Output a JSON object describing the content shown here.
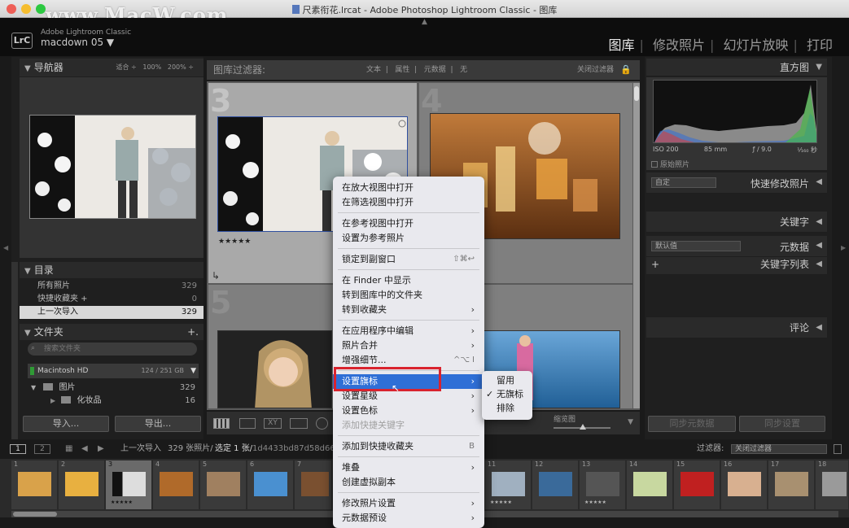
{
  "window": {
    "title": "尺素衔花.lrcat - Adobe Photoshop Lightroom Classic - 图库",
    "watermark": "www.MacW.com"
  },
  "identity": {
    "app": "Adobe Lightroom Classic",
    "user": "macdown 05 ▼",
    "badge": "LrC"
  },
  "modules": [
    "图库",
    "修改照片",
    "幻灯片放映",
    "打印"
  ],
  "navigator": {
    "title": "导航器",
    "zoom": [
      "适合 ÷",
      "100%",
      "200% ÷"
    ]
  },
  "catalog": {
    "title": "目录",
    "items": [
      {
        "label": "所有照片",
        "count": "329"
      },
      {
        "label": "快捷收藏夹 +",
        "count": "0"
      },
      {
        "label": "上一次导入",
        "count": "329"
      }
    ]
  },
  "folders": {
    "title": "文件夹",
    "search_placeholder": "搜索文件夹",
    "volume": "Macintosh HD",
    "volume_size": "124 / 251 GB",
    "items": [
      {
        "label": "图片",
        "count": "329"
      },
      {
        "label": "化妆品",
        "count": "16"
      }
    ]
  },
  "left_buttons": {
    "import": "导入...",
    "export": "导出..."
  },
  "filter_bar": {
    "label": "图库过滤器:",
    "options": [
      "文本",
      "属性",
      "元数据",
      "无"
    ],
    "close": "关闭过滤器"
  },
  "grid": {
    "cells": [
      "3",
      "4",
      "5"
    ],
    "rating": "★★★★★"
  },
  "right": {
    "histogram": "直方图",
    "iso": "ISO 200",
    "focal": "85 mm",
    "aperture": "ƒ / 9.0",
    "shutter": "¹⁄₁₆₀ 秒",
    "original": "原始照片",
    "preset": "自定",
    "quick_develop": "快速修改照片",
    "keywords": "关键字",
    "keyword_list": "关键字列表",
    "metadata_preset": "默认值",
    "metadata": "元数据",
    "comments": "评论",
    "sync_meta": "同步元数据",
    "sync_settings": "同步设置"
  },
  "toolbar": {
    "thumb_label": "缩览图"
  },
  "context_menu": [
    {
      "label": "在放大视图中打开",
      "shortcut": "",
      "arrow": false
    },
    {
      "label": "在筛选视图中打开",
      "shortcut": "",
      "arrow": false
    },
    {
      "label": "在参考视图中打开",
      "shortcut": "",
      "arrow": false
    },
    {
      "label": "设置为参考照片",
      "shortcut": "",
      "arrow": false
    },
    {
      "label": "锁定到副窗口",
      "shortcut": "⇧⌘↩",
      "arrow": false
    },
    {
      "label": "在 Finder 中显示",
      "shortcut": "",
      "arrow": false
    },
    {
      "label": "转到图库中的文件夹",
      "shortcut": "",
      "arrow": false
    },
    {
      "label": "转到收藏夹",
      "shortcut": "",
      "arrow": true
    },
    {
      "label": "在应用程序中编辑",
      "shortcut": "",
      "arrow": true
    },
    {
      "label": "照片合并",
      "shortcut": "",
      "arrow": true
    },
    {
      "label": "增强细节...",
      "shortcut": "^⌥ I",
      "arrow": false
    },
    {
      "label": "设置旗标",
      "shortcut": "",
      "arrow": true
    },
    {
      "label": "设置星级",
      "shortcut": "",
      "arrow": true
    },
    {
      "label": "设置色标",
      "shortcut": "",
      "arrow": true
    },
    {
      "label": "添加快捷关键字",
      "shortcut": "",
      "arrow": false
    },
    {
      "label": "添加到快捷收藏夹",
      "shortcut": "B",
      "arrow": false
    },
    {
      "label": "堆叠",
      "shortcut": "",
      "arrow": true
    },
    {
      "label": "创建虚拟副本",
      "shortcut": "",
      "arrow": false
    },
    {
      "label": "修改照片设置",
      "shortcut": "",
      "arrow": true
    },
    {
      "label": "元数据预设",
      "shortcut": "",
      "arrow": true
    }
  ],
  "submenu": [
    {
      "label": "留用"
    },
    {
      "label": "无旗标",
      "check": "✓"
    },
    {
      "label": "排除"
    }
  ],
  "filmstrip_bar": {
    "view1": "1",
    "view2": "2",
    "source": "上一次导入",
    "count": "329 张照片/",
    "selected": "选定 1 张/",
    "file": "1d4433bd87d58d664cc",
    "filter_label": "过滤器:",
    "filter_value": "关闭过滤器"
  },
  "filmstrip": [
    "1",
    "2",
    "3",
    "4",
    "5",
    "6",
    "7",
    "11",
    "12",
    "13",
    "14",
    "15",
    "16",
    "17",
    "18"
  ],
  "colors": {
    "accent": "#2f6fd6",
    "highlight_box": "#d9232e"
  }
}
